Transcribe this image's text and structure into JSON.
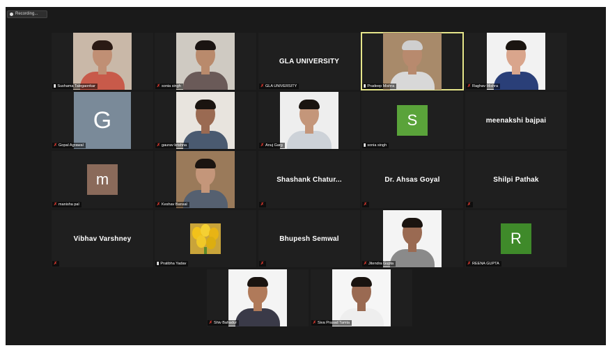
{
  "recording": {
    "label": "Recording..."
  },
  "participants": [
    {
      "name": "Sushama Talegaonkar",
      "type": "video",
      "muted": false,
      "bg": "#c9b8a8",
      "skin": "#c08f74",
      "shirt": "#c85a4a",
      "hair": "#2a1a14"
    },
    {
      "name": "sonia singh",
      "type": "video",
      "muted": true,
      "bg": "#cfcac2",
      "skin": "#b98a6c",
      "shirt": "#6a5a58",
      "hair": "#1a1412"
    },
    {
      "name": "GLA UNIVERSITY",
      "display": "GLA UNIVERSITY",
      "type": "name",
      "muted": true
    },
    {
      "name": "Pradeep Mishra",
      "type": "video",
      "muted": false,
      "active": true,
      "bg": "#a88a6a",
      "skin": "#b88a6e",
      "shirt": "#d8d8d8",
      "hair": "#cfcfcf"
    },
    {
      "name": "Raghav Mishra",
      "type": "video",
      "muted": true,
      "bg": "#f2f2f2",
      "skin": "#d9a58c",
      "shirt": "#2a3f78",
      "hair": "#1a1410"
    },
    {
      "name": "Gopal Agrawal",
      "type": "avatar",
      "muted": true,
      "letter": "G",
      "color": "#7a8a99"
    },
    {
      "name": "gaurav krishna",
      "type": "video",
      "muted": true,
      "bg": "#e8e4de",
      "skin": "#9a6a52",
      "shirt": "#4a5a70",
      "hair": "#1a1410"
    },
    {
      "name": "Anuj Garg",
      "type": "video",
      "muted": true,
      "bg": "#eeeeee",
      "skin": "#c4967a",
      "shirt": "#cdd2d8",
      "hair": "#1a1410"
    },
    {
      "name": "sonia singh",
      "type": "avatar",
      "muted": false,
      "letter": "S",
      "color": "#5aa33a"
    },
    {
      "name": "meenakshi bajpai",
      "display": "meenakshi bajpai",
      "type": "name",
      "muted": false,
      "noBar": true
    },
    {
      "name": "manisha pal",
      "type": "avatar",
      "muted": true,
      "letter": "m",
      "color": "#8a6a5a"
    },
    {
      "name": "Keshav Bansal",
      "type": "video",
      "muted": true,
      "bg": "#9a7a5a",
      "skin": "#c4967a",
      "shirt": "#556070",
      "hair": "#1a1410"
    },
    {
      "name": "",
      "display": "Shashank  Chatur...",
      "type": "name",
      "muted": true
    },
    {
      "name": "",
      "display": "Dr. Ahsas Goyal",
      "type": "name",
      "muted": true
    },
    {
      "name": "",
      "display": "Shilpi Pathak",
      "type": "name",
      "muted": true
    },
    {
      "name": "",
      "display": "Vibhav Varshney",
      "type": "name",
      "muted": true
    },
    {
      "name": "Pratibha Yadav",
      "type": "flower",
      "muted": false
    },
    {
      "name": "",
      "display": "Bhupesh Semwal",
      "type": "name",
      "muted": true
    },
    {
      "name": "Jitendra Gupta",
      "type": "video",
      "muted": true,
      "bg": "#f4f4f4",
      "skin": "#9a6a52",
      "shirt": "#8a8a8a",
      "hair": "#1a1410"
    },
    {
      "name": "REENA GUPTA",
      "type": "avatar",
      "muted": true,
      "letter": "R",
      "color": "#3f8a2a"
    },
    {
      "name": "Shiv Bahadur",
      "type": "video",
      "muted": true,
      "bg": "#f4f4f4",
      "skin": "#b07a5a",
      "shirt": "#3a3a48",
      "hair": "#1a1410"
    },
    {
      "name": "Siva Prasad Tamta",
      "type": "video",
      "muted": true,
      "bg": "#f6f6f6",
      "skin": "#9a6a52",
      "shirt": "#eeeeee",
      "hair": "#1a1410"
    }
  ]
}
